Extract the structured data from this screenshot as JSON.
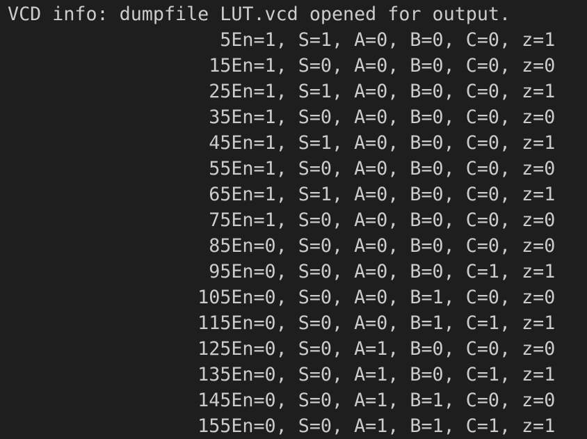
{
  "terminal": {
    "lines": [
      "VCD info: dumpfile LUT.vcd opened for output.",
      "                   5En=1, S=1, A=0, B=0, C=0, z=1",
      "                  15En=1, S=0, A=0, B=0, C=0, z=0",
      "                  25En=1, S=1, A=0, B=0, C=0, z=1",
      "                  35En=1, S=0, A=0, B=0, C=0, z=0",
      "                  45En=1, S=1, A=0, B=0, C=0, z=1",
      "                  55En=1, S=0, A=0, B=0, C=0, z=0",
      "                  65En=1, S=1, A=0, B=0, C=0, z=1",
      "                  75En=1, S=0, A=0, B=0, C=0, z=0",
      "                  85En=0, S=0, A=0, B=0, C=0, z=0",
      "                  95En=0, S=0, A=0, B=0, C=1, z=1",
      "                 105En=0, S=0, A=0, B=1, C=0, z=0",
      "                 115En=0, S=0, A=0, B=1, C=1, z=1",
      "                 125En=0, S=0, A=1, B=0, C=0, z=0",
      "                 135En=0, S=0, A=1, B=0, C=1, z=1",
      "                 145En=0, S=0, A=1, B=1, C=0, z=0",
      "                 155En=0, S=0, A=1, B=1, C=1, z=1"
    ]
  }
}
